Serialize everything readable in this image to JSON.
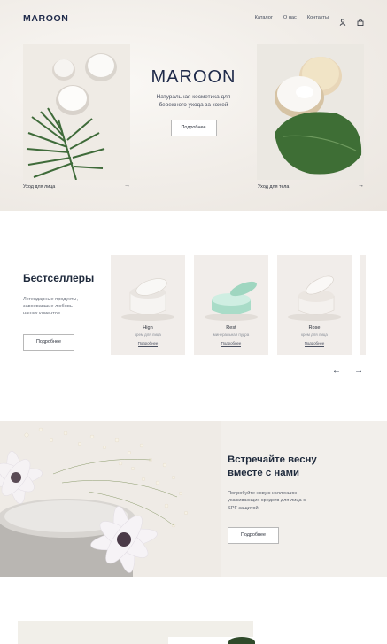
{
  "header": {
    "logo": "MAROON",
    "nav": [
      "Каталог",
      "О нас",
      "Контакты"
    ],
    "icons": [
      "user-icon",
      "bag-icon"
    ]
  },
  "hero": {
    "title": "MAROON",
    "subtitle_line1": "Натуральная косметика для",
    "subtitle_line2": "бережного ухода за кожей",
    "button": "Подробнее",
    "left_caption": "Уход для лица",
    "right_caption": "Уход для тела",
    "arrow": "→"
  },
  "bestsellers": {
    "title": "Бестселлеры",
    "description_line1": "Легендарные продукты,",
    "description_line2": "завоевавшие любовь",
    "description_line3": "наших клиентов",
    "button": "Подробнее",
    "products": [
      {
        "name": "High",
        "kind": "крем для лица",
        "more": "Подробнее"
      },
      {
        "name": "Rest",
        "kind": "минеральная пудра",
        "more": "Подробнее"
      },
      {
        "name": "Rose",
        "kind": "крем для лица",
        "more": "Подробнее"
      }
    ],
    "prev": "←",
    "next": "→"
  },
  "spring": {
    "title_line1": "Встречайте весну",
    "title_line2": "вместе с нами",
    "description_line1": "Попробуйте новую коллекцию",
    "description_line2": "ухаживающих средств для лица с",
    "description_line3": "SPF защитой",
    "button": "Подробнее"
  },
  "colors": {
    "brand": "#1f2a4a",
    "hero_bg": "#f1ede8",
    "card_bg": "#f1edea",
    "leaf_green": "#3f6b3a",
    "mint": "#a8d8c4"
  }
}
